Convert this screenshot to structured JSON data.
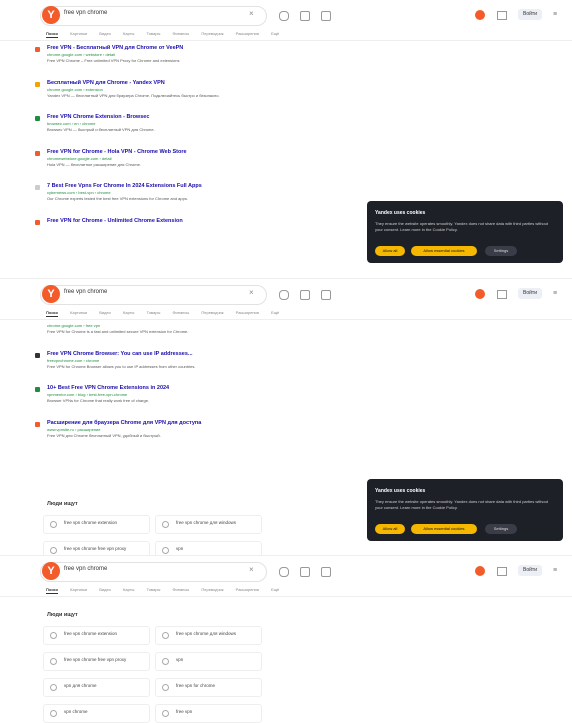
{
  "header": {
    "logo_letter": "Y",
    "query": "free vpn chrome",
    "clear_icon": "close-icon",
    "signin_label": "Войти"
  },
  "tabs": [
    "Поиск",
    "Картинки",
    "Видео",
    "Карты",
    "Товары",
    "Финансы",
    "Переводчик",
    "Расширения",
    "Ещё"
  ],
  "results_panel1": [
    {
      "title": "Free VPN - Бесплатный VPN для Chrome от VeePN",
      "url": "chrome.google.com › webstore › detail",
      "snippet": "Free VPN Chrome – Free unlimited VPN Proxy for Chrome and extensions",
      "fav": "#f45b2a"
    },
    {
      "title": "Бесплатный VPN для Chrome - Yandex VPN",
      "url": "chrome.google.com › extension",
      "snippet": "Yandex VPN — бесплатный VPN для браузера Chrome. Подключайтесь быстро и безопасно.",
      "fav": "#f5a300"
    },
    {
      "title": "Free VPN Chrome Extension - Browsec",
      "url": "browsec.com › en › chrome",
      "snippet": "Browsec VPN — быстрый и бесплатный VPN для Chrome.",
      "fav": "#1e8e3e"
    },
    {
      "title": "Free VPN for Chrome - Hola VPN - Chrome Web Store",
      "url": "chromewebstore.google.com › detail",
      "snippet": "Hola VPN — бесплатное расширение для Chrome.",
      "fav": "#f45b2a"
    },
    {
      "title": "7 Best Free Vpns For Chrome In 2024 Extensions Full Apps",
      "url": "cybernews.com › best-vpn › chrome",
      "snippet": "Our Chrome experts tested the best free VPN extensions for Chrome and apps.",
      "fav": "#cccccc"
    },
    {
      "title": "Free VPN for Chrome - Unlimited Chrome Extension",
      "url": "",
      "snippet": "",
      "fav": "#f45b2a"
    }
  ],
  "results_panel2": [
    {
      "title": "",
      "url": "chrome.google.com › free vpn",
      "snippet": "Free VPN for Chrome is a fast and unlimited secure VPN extension for Chrome.",
      "fav": ""
    },
    {
      "title": "Free VPN Chrome Browser: You can use IP addresses...",
      "url": "freevpnchrome.com › chrome",
      "snippet": "Free VPN for Chrome Browser allows you to use IP addresses from other countries.",
      "fav": "#333333"
    },
    {
      "title": "10+ Best Free VPN Chrome Extensions in 2024",
      "url": "vpnmentor.com › blog › best-free-vpn-chrome",
      "snippet": "Browser VPNs for Chrome that really work free of charge.",
      "fav": "#1e8e3e"
    },
    {
      "title": "Расширение для браузера Chrome для VPN для доступа",
      "url": "www.vpnsite.ru › расширение",
      "snippet": "Free VPN для Chrome бесплатный VPN, удобный и быстрый.",
      "fav": "#f45b2a"
    }
  ],
  "paa": {
    "title": "Люди ищут",
    "items": [
      "free vpn chrome extension",
      "free vpn chrome для windows",
      "free vpn chrome free vpn proxy",
      "vpn",
      "vpn для chrome",
      "free vpn for chrome",
      "vpn chrome",
      "free vpn"
    ]
  },
  "cookie": {
    "title": "Yandex uses cookies",
    "text": "They ensure the website operates smoothly. Yandex does not share data with third parties without your consent. Learn more in the Cookie Policy.",
    "accept": "Allow all",
    "manage": "Allow essential cookies",
    "settings": "Settings"
  }
}
